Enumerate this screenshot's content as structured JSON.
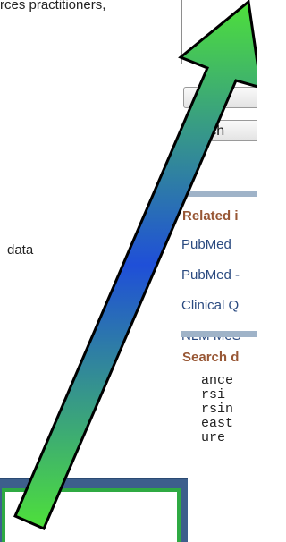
{
  "article": {
    "top_line": "rces practitioners,",
    "data_line": "data"
  },
  "sidebar": {
    "add_button_label": "to",
    "search_button_label": "arch",
    "related_heading": "Related i",
    "related_items": [
      {
        "label": "PubMed"
      },
      {
        "label": "PubMed -"
      },
      {
        "label": "Clinical Q"
      },
      {
        "label": "NLM MeS"
      }
    ],
    "search_details_heading": "Search d",
    "search_details_lines": [
      "ance",
      "rsi",
      "rsin",
      "east",
      "ure"
    ]
  },
  "overlay": {
    "arrow_icon": "arrow-icon",
    "arrow_fill_top": "#4ee03a",
    "arrow_fill_mid": "#1f4fd8",
    "arrow_outline": "#000000"
  },
  "colors": {
    "heading": "#985735",
    "link": "#2a4a80",
    "panel_blue": "#3d5f8c",
    "panel_green": "#2faa43"
  }
}
